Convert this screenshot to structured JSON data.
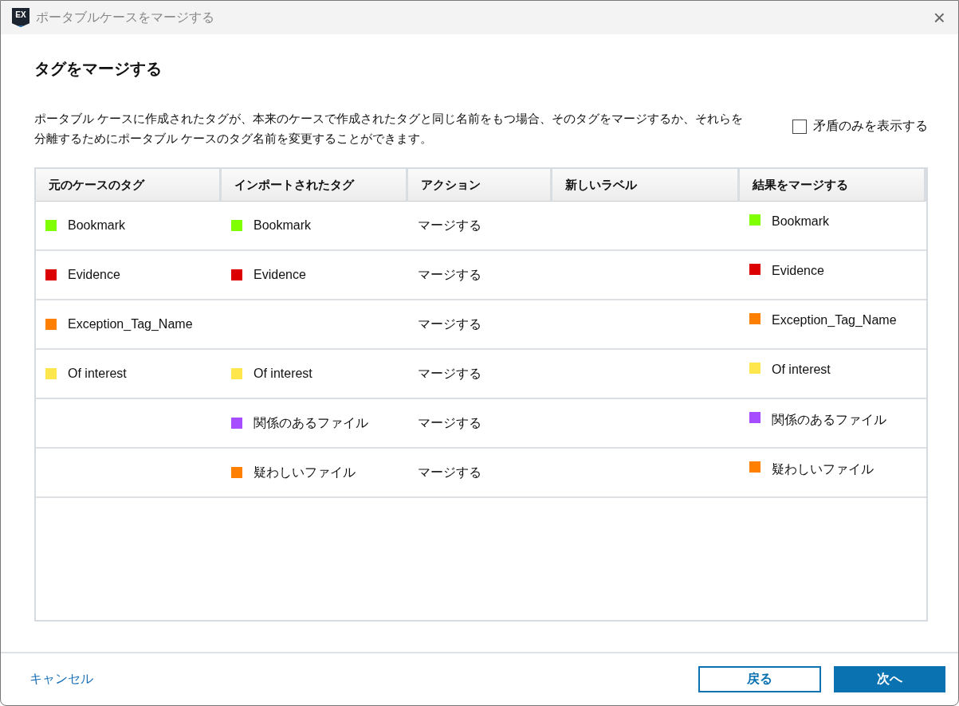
{
  "window": {
    "title": "ポータブルケースをマージする",
    "app_icon_text": "EX",
    "close": "×"
  },
  "heading": "タグをマージする",
  "description": "ポータブル ケースに作成されたタグが、本来のケースで作成されたタグと同じ名前をもつ場合、そのタグをマージするか、それらを分離するためにポータブル ケースのタグ名前を変更することができます。",
  "conflicts_only": {
    "label": "矛盾のみを表示する",
    "checked": false
  },
  "table": {
    "columns": [
      "元のケースのタグ",
      "インポートされたタグ",
      "アクション",
      "新しいラベル",
      "結果をマージする"
    ],
    "rows": [
      {
        "original": {
          "name": "Bookmark",
          "color": "#80ff00"
        },
        "imported": {
          "name": "Bookmark",
          "color": "#80ff00"
        },
        "action": "マージする",
        "result": {
          "name": "Bookmark",
          "color": "#80ff00"
        }
      },
      {
        "original": {
          "name": "Evidence",
          "color": "#dd0000"
        },
        "imported": {
          "name": "Evidence",
          "color": "#dd0000"
        },
        "action": "マージする",
        "result": {
          "name": "Evidence",
          "color": "#dd0000"
        }
      },
      {
        "original": {
          "name": "Exception_Tag_Name",
          "color": "#ff7f00"
        },
        "action": "マージする",
        "result": {
          "name": "Exception_Tag_Name",
          "color": "#ff7f00"
        }
      },
      {
        "original": {
          "name": "Of interest",
          "color": "#ffe64d"
        },
        "imported": {
          "name": "Of interest",
          "color": "#ffe64d"
        },
        "action": "マージする",
        "result": {
          "name": "Of interest",
          "color": "#ffe64d"
        }
      },
      {
        "imported": {
          "name": "関係のあるファイル",
          "color": "#a64dff"
        },
        "action": "マージする",
        "result": {
          "name": "関係のあるファイル",
          "color": "#a64dff"
        }
      },
      {
        "imported": {
          "name": "疑わしいファイル",
          "color": "#ff7f00"
        },
        "action": "マージする",
        "result": {
          "name": "疑わしいファイル",
          "color": "#ff7f00"
        }
      }
    ]
  },
  "footer": {
    "cancel": "キャンセル",
    "back": "戻る",
    "next": "次へ"
  }
}
